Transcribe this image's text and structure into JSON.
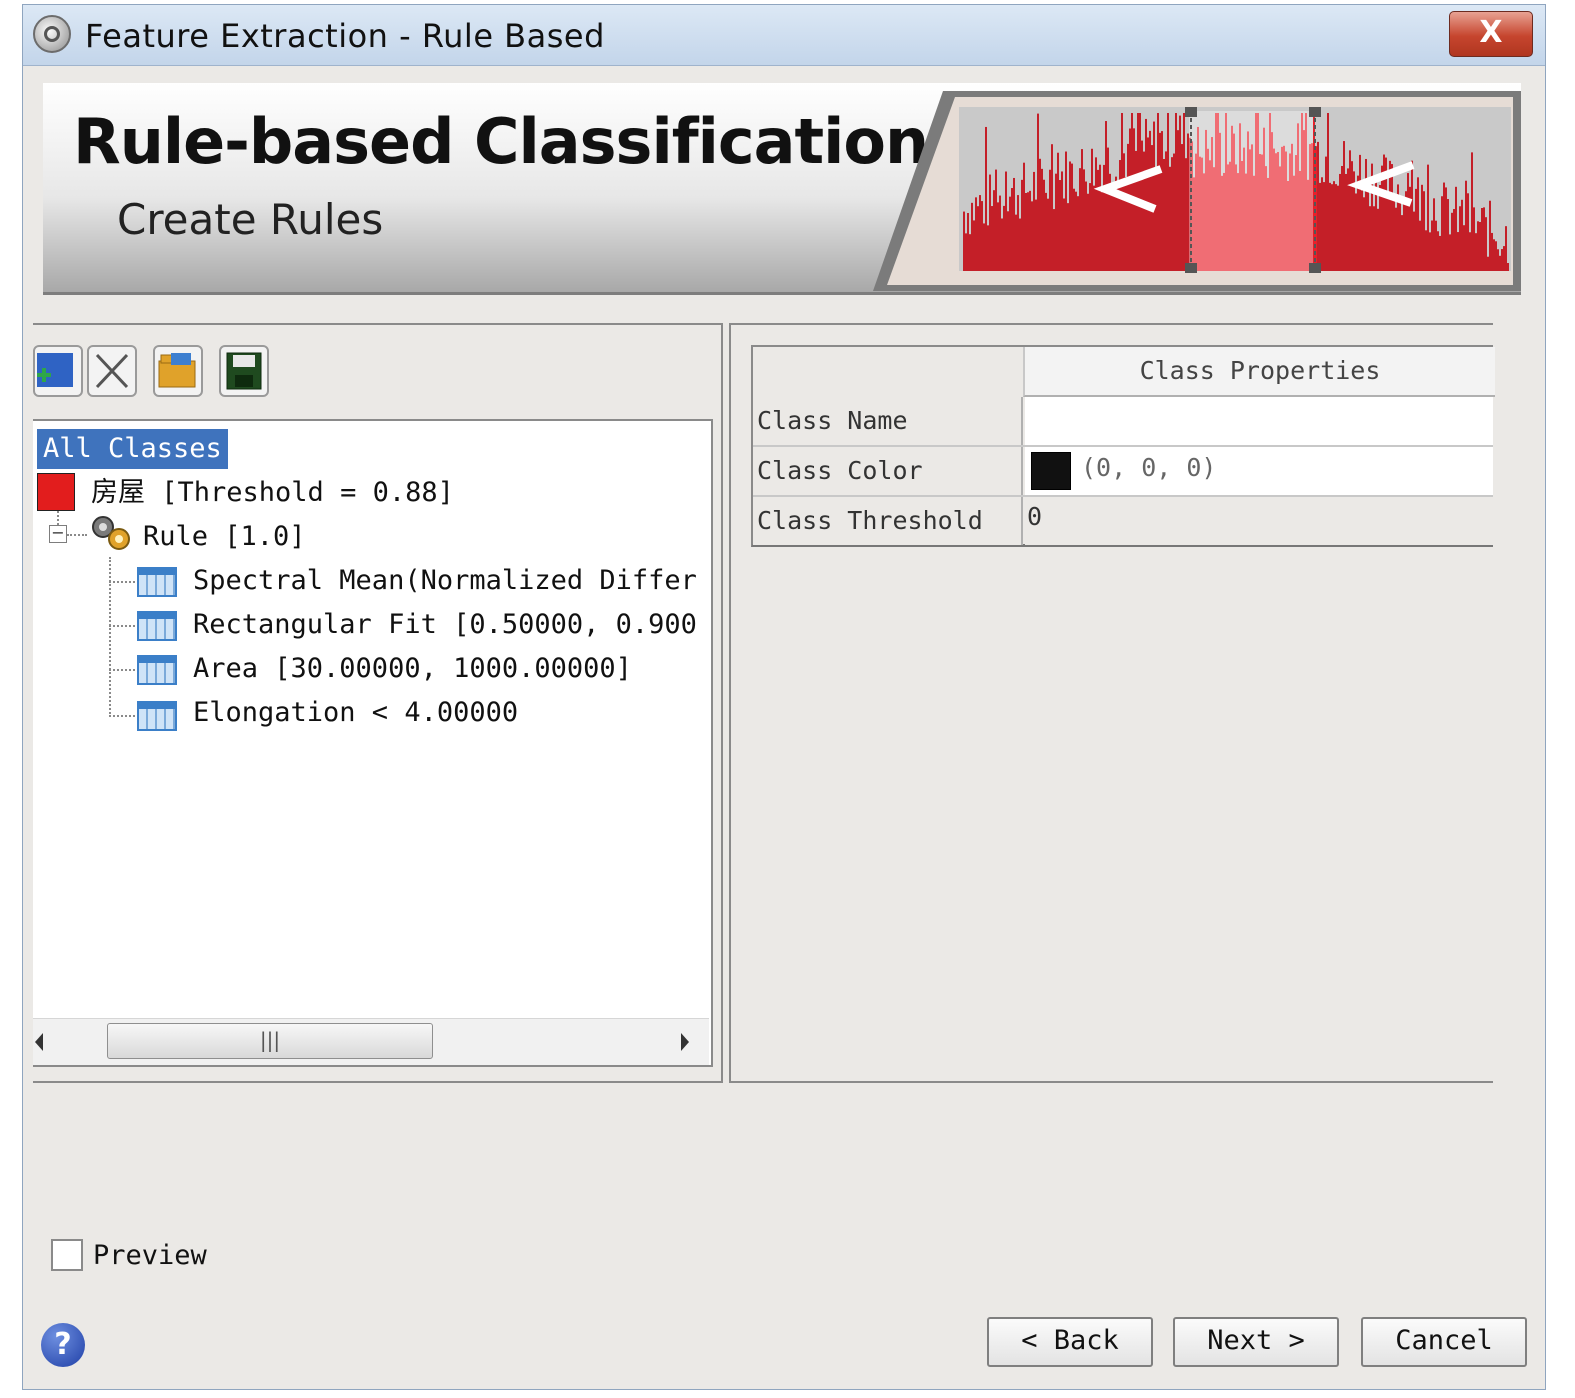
{
  "window": {
    "title": "Feature Extraction - Rule Based",
    "close_label": "X"
  },
  "banner": {
    "title": "Rule-based Classification",
    "subtitle": "Create Rules"
  },
  "tree": {
    "root": "All Classes",
    "class_label": "房屋 [Threshold = 0.88]",
    "class_color": "#e21d1d",
    "rule_label": "Rule [1.0]",
    "expand_symbol": "−",
    "items": [
      "Spectral Mean(Normalized Differ",
      "Rectangular Fit [0.50000, 0.900",
      "Area [30.00000, 1000.00000]",
      "Elongation < 4.00000"
    ],
    "scroll_grip": "|||"
  },
  "properties": {
    "header": "Class Properties",
    "rows": [
      {
        "key": "Class Name",
        "value": ""
      },
      {
        "key": "Class Color",
        "value": "(0, 0, 0)",
        "swatch": "#111111"
      },
      {
        "key": "Class Threshold",
        "value": "0"
      }
    ]
  },
  "preview": {
    "label": "Preview",
    "checked": false
  },
  "help": {
    "label": "?"
  },
  "buttons": {
    "back": "< Back",
    "next": "Next >",
    "cancel": "Cancel"
  },
  "icons": [
    "window-app-icon",
    "close-icon",
    "add-class-icon",
    "delete-icon",
    "open-folder-icon",
    "save-icon",
    "rule-gear-icon",
    "table-icon",
    "help-icon"
  ]
}
